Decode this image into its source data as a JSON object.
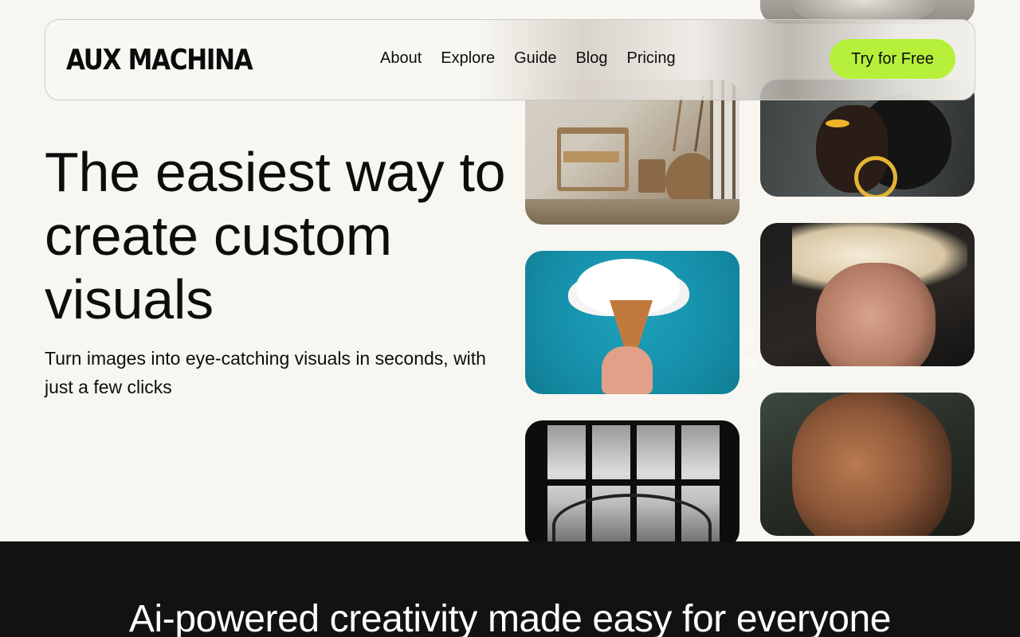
{
  "brand": {
    "logo": "AUX MACHINA"
  },
  "nav": {
    "links": [
      "About",
      "Explore",
      "Guide",
      "Blog",
      "Pricing"
    ],
    "cta": "Try for Free"
  },
  "hero": {
    "title": "The easiest way to create custom visuals",
    "subtitle": "Turn images into eye-catching visuals in seconds, with just a few clicks"
  },
  "section2": {
    "title": "Ai-powered creativity made easy for everyone"
  },
  "gallery": {
    "images": [
      "room-interior-image",
      "ice-cream-cloud-image",
      "harbour-bridge-window-image",
      "sculpture-image",
      "woman-portrait-image",
      "blond-man-portrait-image",
      "old-man-portrait-image"
    ]
  },
  "colors": {
    "accent": "#b6f03b",
    "background": "#f7f6f1",
    "dark": "#121212"
  }
}
